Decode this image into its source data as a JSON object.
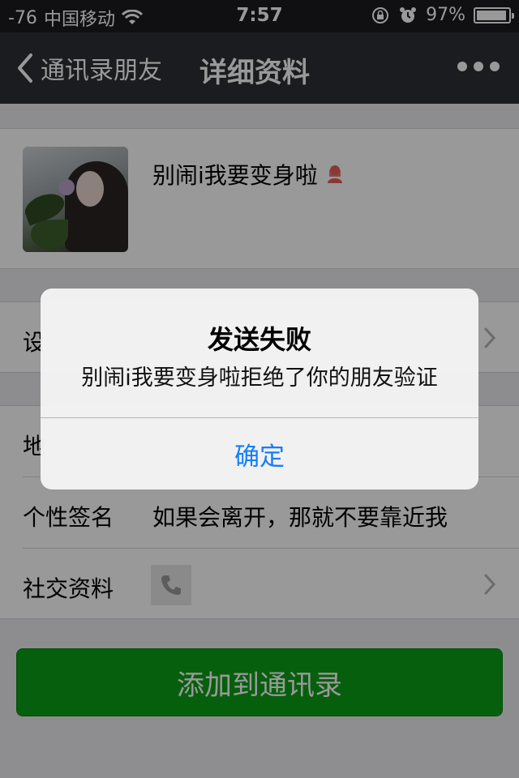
{
  "status_bar": {
    "signal": "-76",
    "carrier": "中国移动",
    "time": "7:57",
    "battery": "97%"
  },
  "nav": {
    "back_label": "通讯录朋友",
    "title": "详细资料"
  },
  "profile": {
    "name": "别闹i我要变身啦"
  },
  "rows": {
    "set_remark_partial": "设",
    "region_partial": "地",
    "signature_label": "个性签名",
    "signature_value": "如果会离开，那就不要靠近我",
    "social_label": "社交资料"
  },
  "add_button_label": "添加到通讯录",
  "alert": {
    "title": "发送失败",
    "message": "别闹i我要变身啦拒绝了你的朋友验证",
    "confirm_label": "确定"
  },
  "colors": {
    "nav_bg": "#2e3035",
    "accent_green": "#0b9e15",
    "link_blue": "#147efb",
    "female_icon": "#e0605b"
  }
}
